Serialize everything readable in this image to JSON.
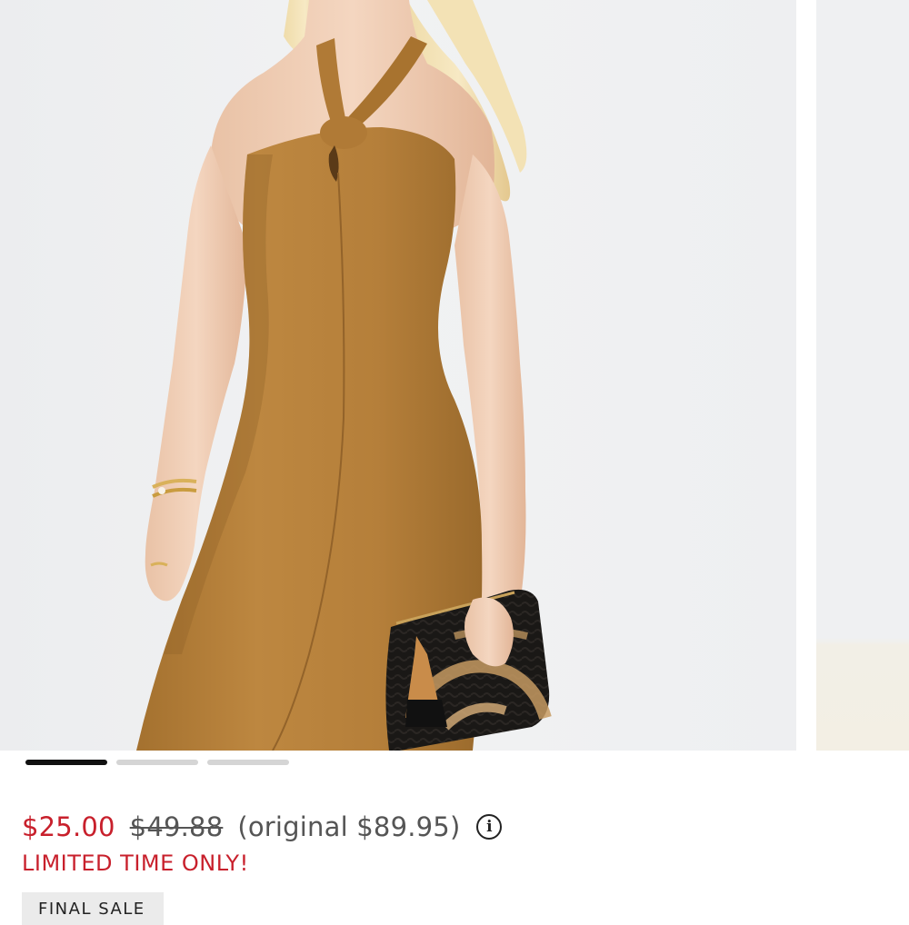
{
  "product": {
    "image_alt": "Model wearing a caramel brown halter midi dress holding a black woven clutch",
    "sale_price": "$25.00",
    "was_price": "$49.88",
    "original_price": "(original $89.95)",
    "info_icon": "info-icon",
    "promo_text": "LIMITED TIME ONLY!",
    "badge": "FINAL SALE"
  },
  "carousel": {
    "slide_count": 3,
    "active_index": 0
  },
  "colors": {
    "sale": "#c8202c",
    "dress": "#b8823c",
    "active_dot": "#111111",
    "inactive_dot": "#d5d5d5"
  }
}
